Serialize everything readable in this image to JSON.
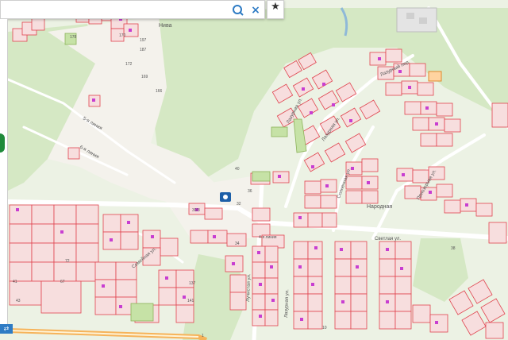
{
  "search": {
    "value": "",
    "placeholder": ""
  },
  "toolbar": {
    "search_icon": "search-icon",
    "clear_label": "×",
    "favorite_label": "★"
  },
  "bottom_tag": "⇄",
  "colors": {
    "forest": "#d5e8c4",
    "field": "#f4f2ec",
    "parcel_fill": "#f7dede",
    "parcel_stroke": "#e0444f",
    "road": "#ffffff",
    "highway": "#f6b35a",
    "building": "#c83ed1",
    "accent": "#2e7bc4"
  },
  "labels": {
    "niva": "Нива",
    "n178": "178",
    "n170": "170",
    "n197": "197",
    "n187": "187",
    "n172": "172",
    "n169": "169",
    "n166": "166",
    "n239": "239",
    "line5": "5-я линия",
    "line6": "6-я линия",
    "n40": "40",
    "n32": "32",
    "n34": "34",
    "n30_3": "30/3",
    "n36": "36",
    "lazurnaya_1": "Лазурная ул.",
    "lazurnaya_2": "Лазурная ул.",
    "lazurny_per": "Лазурный пер.",
    "solnechnaya": "Солнечная ул.",
    "priozernaya": "Приозерная ул.",
    "svetlaya": "Светлая ул.",
    "narodnaya": "Народная",
    "luchistaya": "Лучистая ул.",
    "lazurnaya_v": "Лазурная ул.",
    "semeynaya": "Семейная ул.",
    "line4": "4-я линия",
    "n38": "38",
    "n43": "43",
    "n41": "41",
    "n67": "67",
    "n137": "137",
    "n141": "141",
    "n10": "10",
    "n72": "72",
    "n1": "1"
  }
}
